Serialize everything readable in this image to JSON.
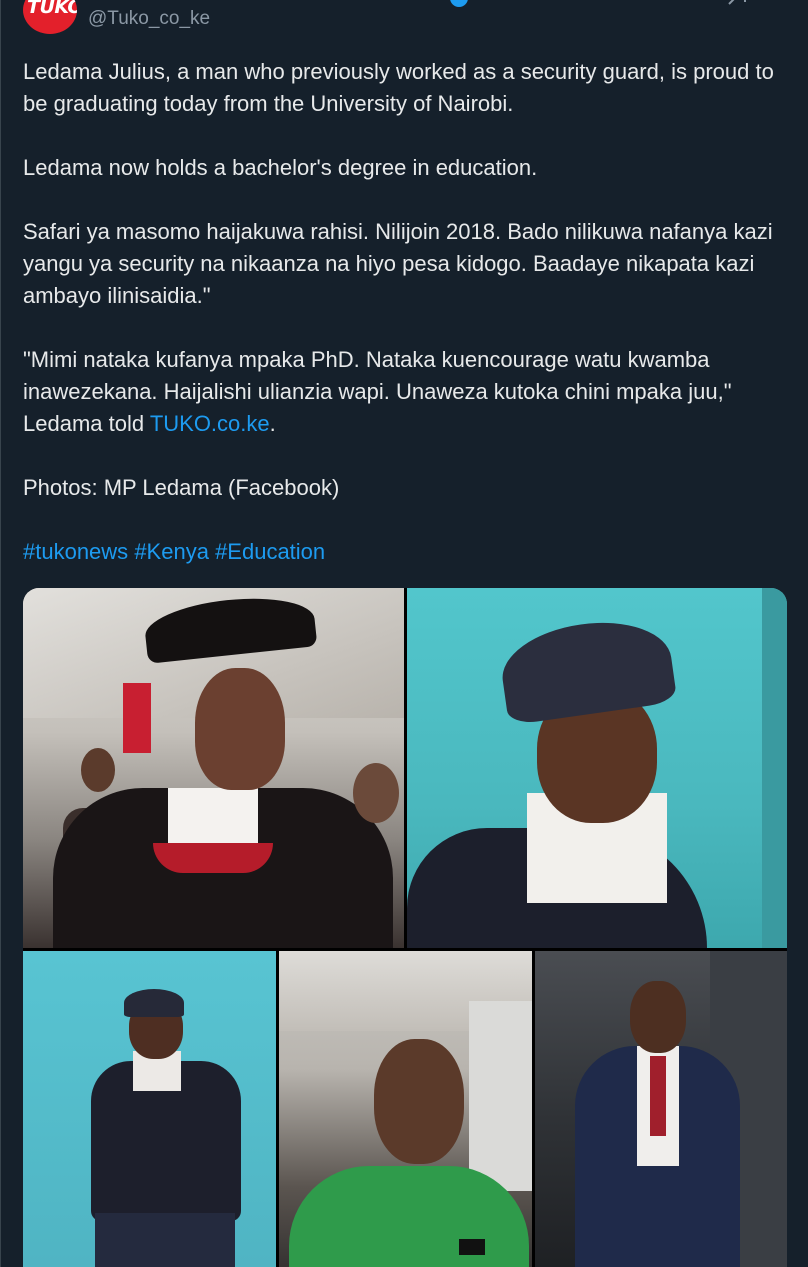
{
  "header": {
    "avatar_text": "TUKO",
    "handle": "@Tuko_co_ke"
  },
  "tweet": {
    "p1": "Ledama Julius, a man who previously worked as a security guard, is proud to be graduating today from the University of Nairobi.",
    "p2": "Ledama now holds a bachelor's degree in education.",
    "p3": "Safari ya masomo haijakuwa rahisi. Nilijoin 2018. Bado nilikuwa nafanya kazi yangu ya security na nikaanza na hiyo pesa kidogo. Baadaye nikapata kazi ambayo ilinisaidia.\"",
    "p4_before": "\"Mimi nataka kufanya mpaka PhD. Nataka kuencourage watu kwamba inawezekana. Haijalishi ulianzia wapi. Unaweza kutoka chini mpaka juu,\" Ledama told ",
    "p4_link": "TUKO.co.ke",
    "p4_after": ".",
    "p5": "Photos: MP Ledama (Facebook)",
    "hashtags": [
      "#tukonews",
      "#Kenya",
      "#Education"
    ]
  },
  "media": {
    "photo_count": 5
  },
  "colors": {
    "background": "#15202b",
    "text": "#e7e9ea",
    "secondary": "#8b98a5",
    "link": "#1d9bf0",
    "brand": "#e3202b"
  }
}
